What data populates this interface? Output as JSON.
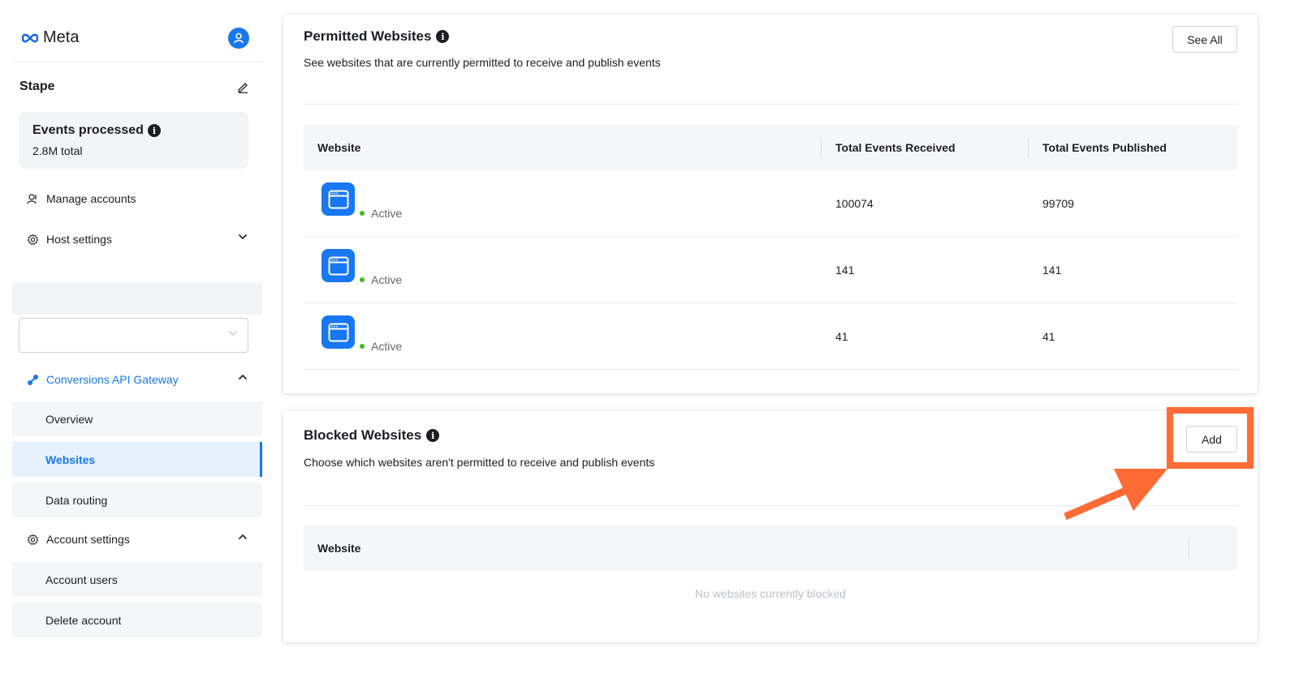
{
  "sidebar": {
    "logo_text": "Meta",
    "business_name": "Stape",
    "events": {
      "title": "Events processed",
      "total": "2.8M total"
    },
    "nav": {
      "manage_accounts": "Manage accounts",
      "host_settings": "Host settings",
      "conversions_api_gateway": "Conversions API Gateway",
      "overview": "Overview",
      "websites": "Websites",
      "data_routing": "Data routing",
      "account_settings": "Account settings",
      "account_users": "Account users",
      "delete_account": "Delete account"
    },
    "select_value": ""
  },
  "permitted": {
    "title": "Permitted Websites",
    "description": "See websites that are currently permitted to receive and publish events",
    "see_all_label": "See All",
    "columns": [
      "Website",
      "Total Events Received",
      "Total Events Published"
    ],
    "rows": [
      {
        "status": "Active",
        "received": "100074",
        "published": "99709"
      },
      {
        "status": "Active",
        "received": "141",
        "published": "141"
      },
      {
        "status": "Active",
        "received": "41",
        "published": "41"
      }
    ]
  },
  "blocked": {
    "title": "Blocked Websites",
    "description": "Choose which websites aren't permitted to receive and publish events",
    "add_label": "Add",
    "columns": [
      "Website"
    ],
    "empty_text": "No websites currently blocked"
  },
  "colors": {
    "accent": "#1877f2",
    "annotation": "#ff6b35",
    "active_dot": "#42b72a"
  },
  "icons": [
    "meta-logo-icon",
    "user-icon",
    "edit-icon",
    "info-icon",
    "manage-accounts-icon",
    "gear-icon",
    "chevron-down-icon",
    "chevron-up-icon",
    "gateway-icon",
    "browser-window-icon",
    "arrow-annotation"
  ]
}
